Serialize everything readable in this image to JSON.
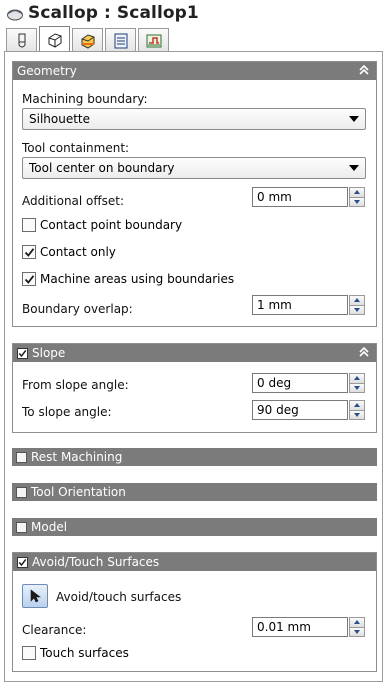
{
  "title": "Scallop : Scallop1",
  "tabs": [
    {
      "icon": "tool-icon",
      "active": false
    },
    {
      "icon": "geometry-icon",
      "active": true
    },
    {
      "icon": "heights-icon",
      "active": false
    },
    {
      "icon": "passes-icon",
      "active": false
    },
    {
      "icon": "linking-icon",
      "active": false
    }
  ],
  "geometry": {
    "header": "Geometry",
    "machining_boundary_label": "Machining boundary:",
    "machining_boundary_value": "Silhouette",
    "tool_containment_label": "Tool containment:",
    "tool_containment_value": "Tool center on boundary",
    "additional_offset_label": "Additional offset:",
    "additional_offset_value": "0 mm",
    "contact_point_boundary_label": "Contact point boundary",
    "contact_point_boundary_checked": false,
    "contact_only_label": "Contact only",
    "contact_only_checked": true,
    "machine_areas_label": "Machine areas using boundaries",
    "machine_areas_checked": true,
    "boundary_overlap_label": "Boundary overlap:",
    "boundary_overlap_value": "1 mm"
  },
  "slope": {
    "header": "Slope",
    "enabled": true,
    "from_label": "From slope angle:",
    "from_value": "0 deg",
    "to_label": "To slope angle:",
    "to_value": "90 deg"
  },
  "rest_machining": {
    "header": "Rest Machining",
    "enabled": false
  },
  "tool_orientation": {
    "header": "Tool Orientation",
    "enabled": false
  },
  "model": {
    "header": "Model",
    "enabled": false
  },
  "avoid": {
    "header": "Avoid/Touch Surfaces",
    "enabled": true,
    "button_label": "Avoid/touch surfaces",
    "clearance_label": "Clearance:",
    "clearance_value": "0.01 mm",
    "touch_surfaces_label": "Touch surfaces",
    "touch_surfaces_checked": false
  },
  "colors": {
    "group_header_bg": "#7b7b7b",
    "group_header_text": "#ffffff",
    "spin_arrow": "#2b4e86",
    "pick_button": "#b9d1ee"
  }
}
